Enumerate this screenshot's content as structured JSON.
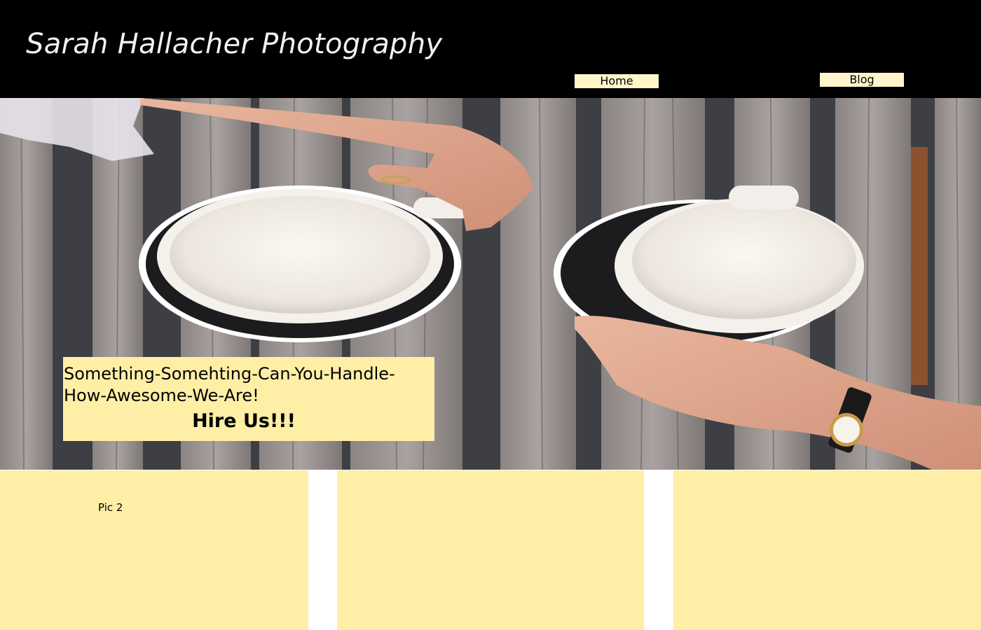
{
  "header": {
    "title": "Sarah Hallacher Photography",
    "nav": [
      {
        "label": "Home"
      },
      {
        "label": "Blog"
      }
    ]
  },
  "hero": {
    "image": "coffee-cups-on-wooden-table",
    "promo": {
      "text": "Something-Somehting-Can-You-Handle-How-Awesome-We-Are!",
      "cta": "Hire Us!!!"
    }
  },
  "tiles": [
    {
      "label": "Pic 2"
    },
    {
      "label": ""
    },
    {
      "label": ""
    }
  ],
  "colors": {
    "header_bg": "#000000",
    "accent_yellow": "#ffeea6",
    "nav_button_bg": "#fff6cc"
  }
}
